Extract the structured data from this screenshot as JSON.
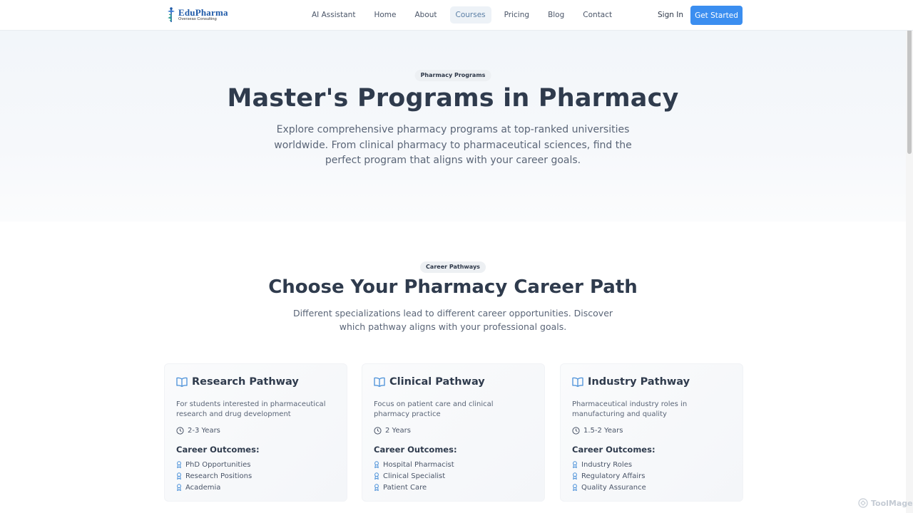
{
  "nav": {
    "logo": {
      "main": "EduPharma",
      "sub": "Overseas Consulting"
    },
    "links": [
      "AI Assistant",
      "Home",
      "About",
      "Courses",
      "Pricing",
      "Blog",
      "Contact"
    ],
    "active": "Courses",
    "sign_in": "Sign In",
    "get_started": "Get Started"
  },
  "hero": {
    "badge": "Pharmacy Programs",
    "title": "Master's Programs in Pharmacy",
    "description": "Explore comprehensive pharmacy programs at top-ranked universities worldwide. From clinical pharmacy to pharmaceutical sciences, find the perfect program that aligns with your career goals."
  },
  "pathways": {
    "badge": "Career Pathways",
    "title": "Choose Your Pharmacy Career Path",
    "description": "Different specializations lead to different career opportunities. Discover which pathway aligns with your professional goals.",
    "outcomes_heading": "Career Outcomes:",
    "cards": [
      {
        "title": "Research Pathway",
        "description": "For students interested in pharmaceutical research and drug development",
        "duration": "2-3 Years",
        "outcomes": [
          "PhD Opportunities",
          "Research Positions",
          "Academia"
        ]
      },
      {
        "title": "Clinical Pathway",
        "description": "Focus on patient care and clinical pharmacy practice",
        "duration": "2 Years",
        "outcomes": [
          "Hospital Pharmacist",
          "Clinical Specialist",
          "Patient Care"
        ]
      },
      {
        "title": "Industry Pathway",
        "description": "Pharmaceutical industry roles in manufacturing and quality",
        "duration": "1.5-2 Years",
        "outcomes": [
          "Industry Roles",
          "Regulatory Affairs",
          "Quality Assurance"
        ]
      }
    ]
  },
  "watermark": "ToolMage",
  "colors": {
    "accent": "#3b8ef0",
    "heading": "#2f3b4d",
    "icon": "#4a90d9"
  }
}
